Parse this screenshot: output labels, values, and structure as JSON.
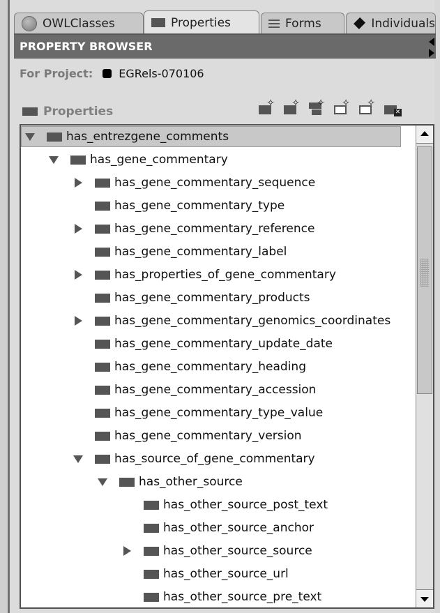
{
  "tabs": [
    {
      "label": "OWLClasses",
      "icon": "owl-classes-icon"
    },
    {
      "label": "Properties",
      "icon": "properties-icon"
    },
    {
      "label": "Forms",
      "icon": "forms-icon"
    },
    {
      "label": "Individuals",
      "icon": "individuals-icon"
    }
  ],
  "header": {
    "title": "PROPERTY BROWSER"
  },
  "project": {
    "label": "For Project:",
    "name": "EGRels-070106"
  },
  "panel": {
    "label": "Properties"
  },
  "tree": [
    {
      "label": "has_entrezgene_comments",
      "level": 0,
      "toggle": "open",
      "selected": true
    },
    {
      "label": "has_gene_commentary",
      "level": 1,
      "toggle": "open"
    },
    {
      "label": "has_gene_commentary_sequence",
      "level": 2,
      "toggle": "closed"
    },
    {
      "label": "has_gene_commentary_type",
      "level": 2,
      "toggle": "none"
    },
    {
      "label": "has_gene_commentary_reference",
      "level": 2,
      "toggle": "closed"
    },
    {
      "label": "has_gene_commentary_label",
      "level": 2,
      "toggle": "none"
    },
    {
      "label": "has_properties_of_gene_commentary",
      "level": 2,
      "toggle": "closed"
    },
    {
      "label": "has_gene_commentary_products",
      "level": 2,
      "toggle": "none"
    },
    {
      "label": "has_gene_commentary_genomics_coordinates",
      "level": 2,
      "toggle": "closed"
    },
    {
      "label": "has_gene_commentary_update_date",
      "level": 2,
      "toggle": "none"
    },
    {
      "label": "has_gene_commentary_heading",
      "level": 2,
      "toggle": "none"
    },
    {
      "label": "has_gene_commentary_accession",
      "level": 2,
      "toggle": "none"
    },
    {
      "label": "has_gene_commentary_type_value",
      "level": 2,
      "toggle": "none"
    },
    {
      "label": "has_gene_commentary_version",
      "level": 2,
      "toggle": "none"
    },
    {
      "label": "has_source_of_gene_commentary",
      "level": 2,
      "toggle": "open"
    },
    {
      "label": "has_other_source",
      "level": 3,
      "toggle": "open"
    },
    {
      "label": "has_other_source_post_text",
      "level": 4,
      "toggle": "none"
    },
    {
      "label": "has_other_source_anchor",
      "level": 4,
      "toggle": "none"
    },
    {
      "label": "has_other_source_source",
      "level": 4,
      "toggle": "closed"
    },
    {
      "label": "has_other_source_url",
      "level": 4,
      "toggle": "none"
    },
    {
      "label": "has_other_source_pre_text",
      "level": 4,
      "toggle": "none"
    }
  ]
}
